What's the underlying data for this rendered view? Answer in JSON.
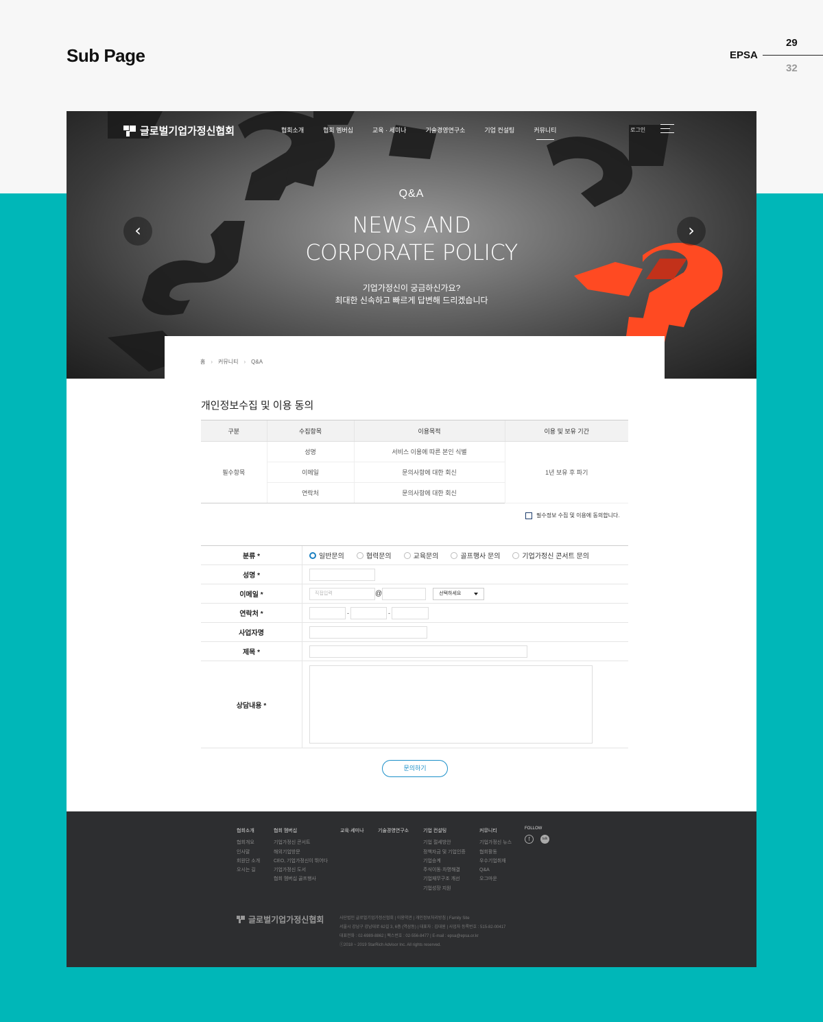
{
  "sheet": {
    "title": "Sub Page",
    "brand": "EPSA",
    "page_current": "29",
    "page_total": "32"
  },
  "header": {
    "logo_text": "글로벌기업가정신협회",
    "nav": [
      "협회소개",
      "협회 멤버십",
      "교육 · 세미나",
      "기술경영연구소",
      "기업 컨설팅",
      "커뮤니티"
    ],
    "active_nav": "커뮤니티",
    "login": "로그인"
  },
  "hero": {
    "category": "Q&A",
    "title_line1": "NEWS AND",
    "title_line2": "CORPORATE POLICY",
    "sub_line1": "기업가정신이 궁금하신가요?",
    "sub_line2": "최대한 신속하고 빠르게 답변해 드리겠습니다",
    "prev": "‹",
    "next": "›"
  },
  "breadcrumb": [
    "홈",
    "커뮤니티",
    "Q&A"
  ],
  "consent": {
    "title": "개인정보수집 및 이용 동의",
    "headers": [
      "구분",
      "수집항목",
      "이용목적",
      "이용 및 보유 기간"
    ],
    "category": "필수항목",
    "rows": [
      {
        "item": "성명",
        "purpose": "서비스 이용에 따른 본인 식별"
      },
      {
        "item": "이메일",
        "purpose": "문의사항에 대한 회신"
      },
      {
        "item": "연락처",
        "purpose": "문의사항에 대한 회신"
      }
    ],
    "period": "1년 보유 후 파기",
    "agree_label": "필수정보 수집 및 이용에 동의합니다."
  },
  "form": {
    "labels": {
      "type": "분류 *",
      "name": "성명 *",
      "email": "이메일 *",
      "phone": "연락처 *",
      "company": "사업자명",
      "subject": "제목 *",
      "content": "상담내용 *"
    },
    "types": [
      "일반문의",
      "협력문의",
      "교육문의",
      "골프행사 문의",
      "기업가정신 콘서트 문의"
    ],
    "selected_type": "일반문의",
    "email_placeholder": "직접입력",
    "email_at": "@",
    "email_select": "선택하세요",
    "phone_dash": "-",
    "submit": "문의하기"
  },
  "footer": {
    "columns": [
      {
        "head": "협회소개",
        "items": [
          "협회개요",
          "인사말",
          "회원단 소개",
          "오시는 길"
        ]
      },
      {
        "head": "협회 멤버십",
        "items": [
          "기업가정신 콘서트",
          "해외기업방문",
          "CEO, 기업가정신이 뛰어다",
          "기업가정신 도서",
          "협회 멤버십 골프행사"
        ]
      },
      {
        "head": "교육·세미나",
        "items": []
      },
      {
        "head": "기술경영연구소",
        "items": []
      },
      {
        "head": "기업 컨설팅",
        "items": [
          "기업 절세방안",
          "정책자금 및 기업인증",
          "기업승계",
          "주식이동·차명해결",
          "기업재무구조 개선",
          "기업성장 지원"
        ]
      },
      {
        "head": "커뮤니티",
        "items": [
          "기업가정신 뉴스",
          "협회활동",
          "우수기업취재",
          "Q&A",
          "오그마운"
        ]
      }
    ],
    "follow": "FOLLOW",
    "logo_text": "글로벌기업가정신협회",
    "info_lines": [
      "사단법인 글로벌기업가정신협회 | 이용약관 | 개인정보처리방침 | Family Site",
      "서울시 강남구 강남대로 62길 3, 6층 (역삼동) | 대표자 : 김대원 | 사업자 등록번호 : 515-82-00417",
      "대표전화 : 02-6989-8862 | 팩스번호 : 02-556-8477 | E-mail : epsa@epsa.or.kr",
      "ⓒ2018 ~ 2019 StarRich Advisor Inc. All rights reserved."
    ]
  }
}
